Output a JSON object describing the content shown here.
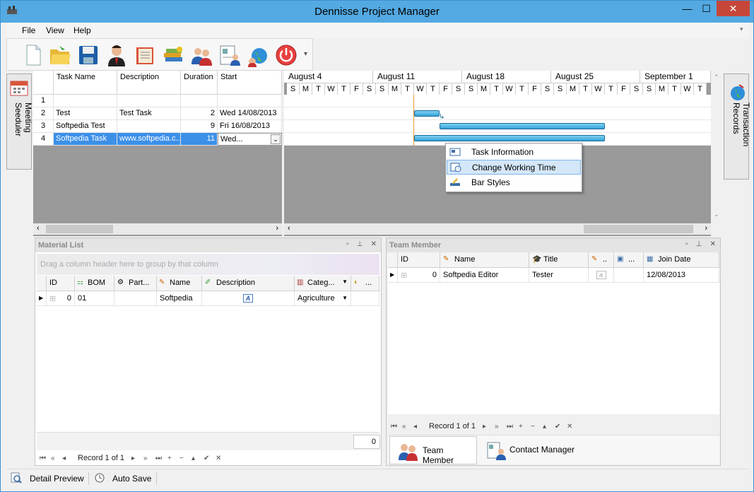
{
  "window": {
    "title": "Dennisse Project Manager",
    "minimize": "—",
    "maximize": "☐",
    "close": "✕"
  },
  "menu": {
    "file": "File",
    "view": "View",
    "help": "Help"
  },
  "toolbar": {
    "buttons": [
      "new-document-icon",
      "open-folder-icon",
      "save-icon",
      "user-icon",
      "address-book-icon",
      "books-icon",
      "team-icon",
      "contact-card-icon",
      "globe-icon",
      "power-icon"
    ],
    "overflow": "▾"
  },
  "sidebars": {
    "left": "Meeting Seeduler",
    "right": "Transaction Records"
  },
  "task_grid": {
    "headers": [
      "Task Name",
      "Description",
      "Duration",
      "Start"
    ],
    "rows": [
      {
        "n": "1",
        "name": "",
        "desc": "",
        "dur": "",
        "start": ""
      },
      {
        "n": "2",
        "name": "Test",
        "desc": "Test Task",
        "dur": "2",
        "start": "Wed 14/08/2013"
      },
      {
        "n": "3",
        "name": "Softpedia Test",
        "desc": "",
        "dur": "9",
        "start": "Fri 16/08/2013"
      },
      {
        "n": "4",
        "name": "Softpedia Task",
        "desc": "www.softpedia.c...",
        "dur": "11",
        "start": "Wed..."
      }
    ]
  },
  "gantt": {
    "weeks": [
      "August 4",
      "August 11",
      "August 18",
      "August 25",
      "September 1"
    ],
    "days": [
      "S",
      "M",
      "T",
      "W",
      "T",
      "F",
      "S"
    ]
  },
  "context_menu": {
    "items": [
      "Task Information",
      "Change Working Time",
      "Bar Styles"
    ]
  },
  "material_list": {
    "title": "Material List",
    "group_hint": "Drag a column header here to group by that column",
    "headers": [
      "ID",
      "BOM",
      "Part...",
      "Name",
      "Description",
      "Categ...",
      "..."
    ],
    "row": {
      "id": "0",
      "bom": "01",
      "part": "",
      "name": "Softpedia",
      "desc_icon": "A",
      "category": "Agriculture"
    },
    "footer_value": "0",
    "record": "Record 1 of 1"
  },
  "team_member": {
    "title": "Team Member",
    "headers": [
      "ID",
      "Name",
      "Title",
      "..",
      "...",
      "Join Date"
    ],
    "row": {
      "id": "0",
      "name": "Softpedia Editor",
      "title": "Tester",
      "a": "a",
      "join": "12/08/2013"
    },
    "record": "Record 1 of 1",
    "tabs": [
      "Team Member",
      "Contact Manager"
    ]
  },
  "nav_symbols": [
    "⏮",
    "«",
    "◂",
    "▸",
    "»",
    "⏭",
    "+",
    "−",
    "▴",
    "✔",
    "✕"
  ],
  "status": {
    "detail": "Detail Preview",
    "autosave": "Auto Save"
  },
  "colors": {
    "titlebar": "#53a9e1",
    "selection": "#3c90e8",
    "bar": "#33a4d8",
    "grid_bg": "#9a9a9a"
  }
}
